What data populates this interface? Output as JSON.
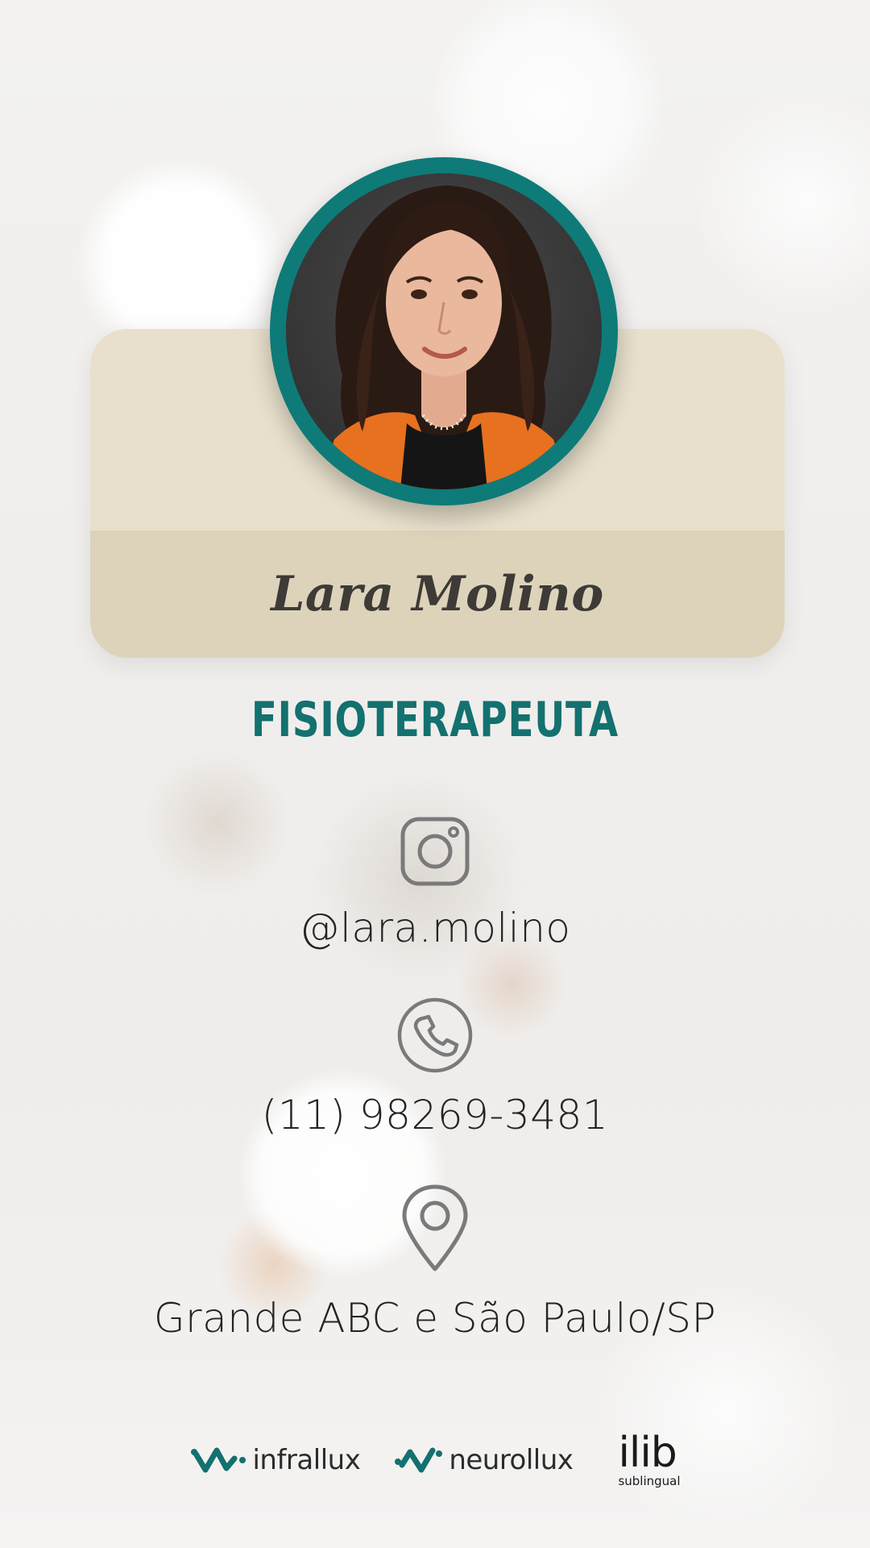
{
  "profile": {
    "name": "Lara Molino",
    "role": "FISIOTERAPEUTA"
  },
  "contacts": {
    "instagram": {
      "icon": "instagram-icon",
      "text": "@lara.molino"
    },
    "phone": {
      "icon": "phone-icon",
      "text": "(11) 98269-3481"
    },
    "location": {
      "icon": "location-pin-icon",
      "text": "Grande ABC e São Paulo/SP"
    }
  },
  "brands": {
    "infrallux": "infrallux",
    "neurollux": "neurollux",
    "ilib_main": "ilib",
    "ilib_sub": "sublingual"
  },
  "colors": {
    "accent": "#13716f",
    "card_top": "#e8e0cc",
    "card_bottom": "#ddd3bb",
    "icon_gray": "#7a7a7a"
  }
}
